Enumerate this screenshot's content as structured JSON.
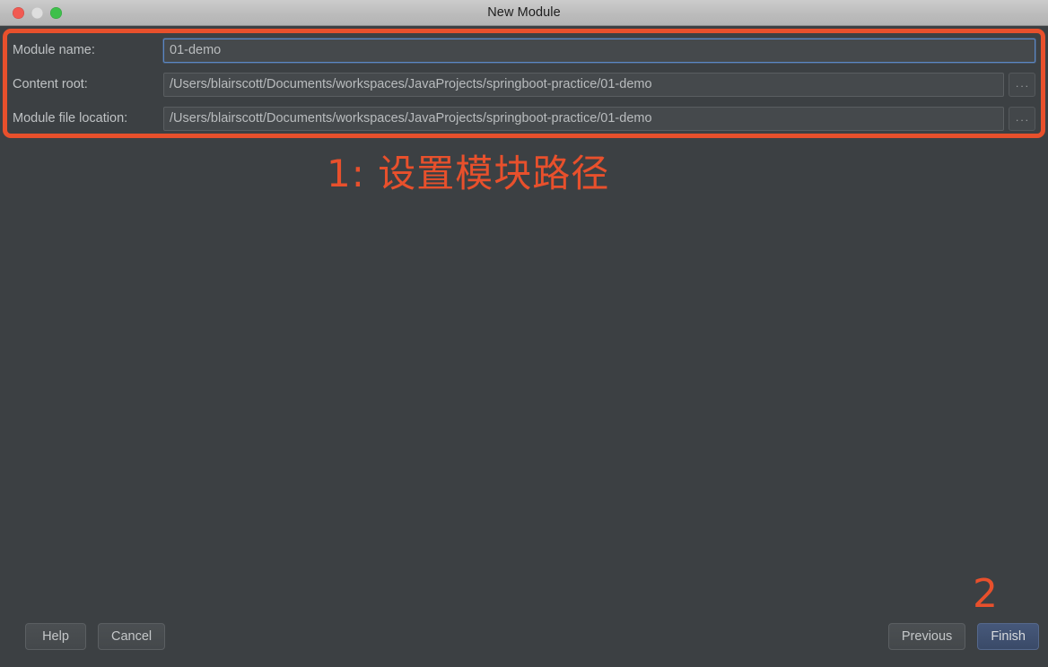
{
  "window": {
    "title": "New Module",
    "traffic_lights": [
      {
        "name": "close",
        "color": "#f15a52"
      },
      {
        "name": "minimize",
        "color": "#dedede"
      },
      {
        "name": "maximize",
        "color": "#3ec04b"
      }
    ]
  },
  "theme": {
    "background": "#3c4043",
    "titlebar": "#bcbcbc",
    "accent_orange": "#e8502c",
    "focus_blue": "#5b87c4",
    "default_button_blue": "#3f5274",
    "text": "#bfc2c4"
  },
  "form": {
    "rows": [
      {
        "label": "Module name:",
        "value": "01-demo",
        "placeholder": "Module name",
        "focused": true,
        "has_browse": false,
        "browse_label": ""
      },
      {
        "label": "Content root:",
        "value": "/Users/blairscott/Documents/workspaces/JavaProjects/springboot-practice/01-demo",
        "placeholder": "Content root",
        "focused": false,
        "has_browse": true,
        "browse_label": "..."
      },
      {
        "label": "Module file location:",
        "value": "/Users/blairscott/Documents/workspaces/JavaProjects/springboot-practice/01-demo",
        "placeholder": "Module file location",
        "focused": false,
        "has_browse": true,
        "browse_label": "..."
      }
    ]
  },
  "annotations": {
    "step1_caption": "1:  设置模块路径",
    "step2_number": "2"
  },
  "footer": {
    "help_label": "Help",
    "cancel_label": "Cancel",
    "previous_label": "Previous",
    "finish_label": "Finish"
  }
}
